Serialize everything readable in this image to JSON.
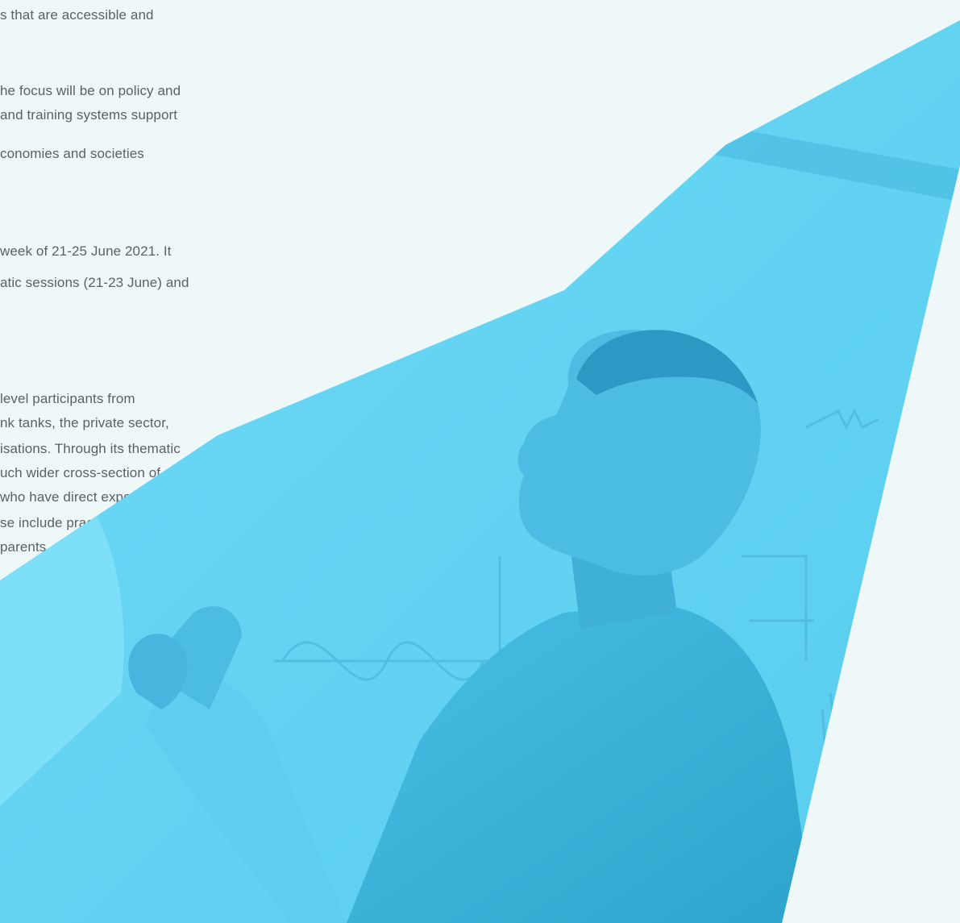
{
  "article": {
    "lines": [
      "s that are accessible and",
      "he focus will be on policy and",
      " and training systems support",
      "conomies and societies",
      " week of 21-25 June 2021. It",
      "atic sessions (21-23 June) and",
      "level participants from",
      "nk tanks, the private sector,",
      "isations. Through its thematic",
      "uch wider cross-section of",
      "who have direct exposure",
      "se include practitioners, civil",
      "parents, public officials, and"
    ]
  },
  "image": {
    "overlay_color": "#64d4f5",
    "shade_color": "#3fb7dc",
    "background_color": "#eef8f8"
  }
}
